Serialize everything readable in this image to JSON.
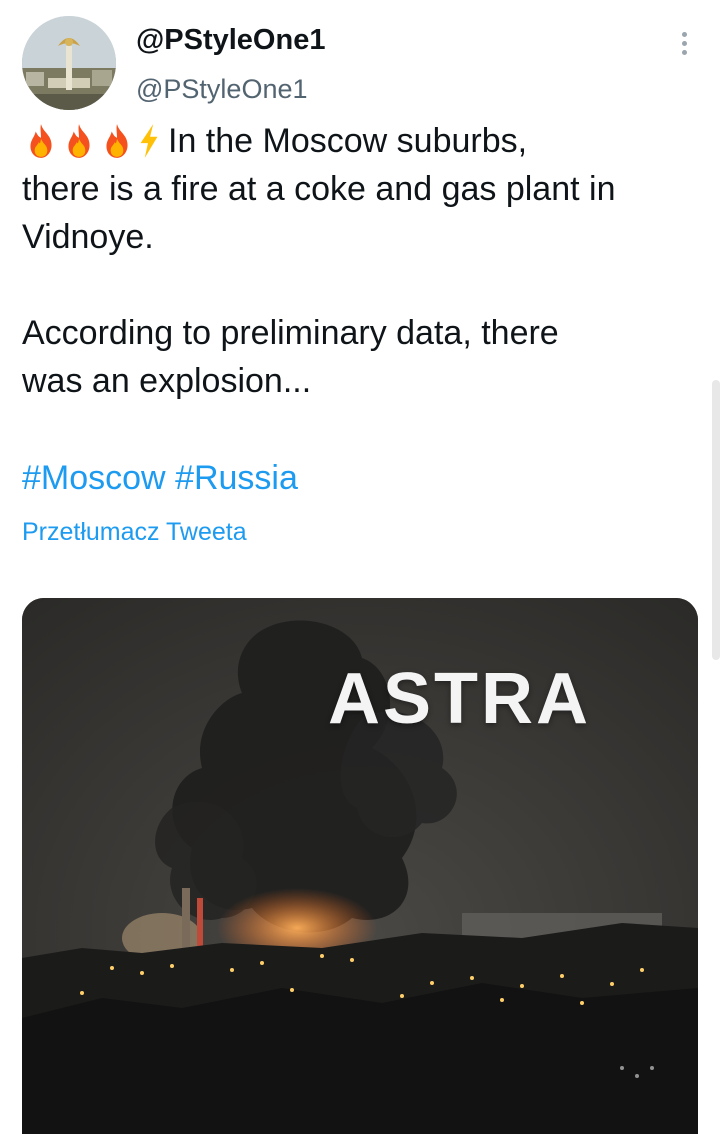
{
  "author": {
    "display_name": "@PStyleOne1",
    "handle": "@PStyleOne1"
  },
  "tweet": {
    "emojis": [
      "fire",
      "fire",
      "fire",
      "lightning"
    ],
    "line1": "In the Moscow suburbs,",
    "line2": "there is a fire at a coke and gas plant in",
    "line3": "Vidnoye.",
    "line4": "According to preliminary data, there",
    "line5": "was an explosion...",
    "hashtags": [
      "#Moscow",
      "#Russia"
    ],
    "translate_label": "Przetłumacz Tweeta"
  },
  "media": {
    "watermark": "ASTRA"
  },
  "colors": {
    "link": "#1d9bf0",
    "text": "#0f1419",
    "secondary": "#536471"
  }
}
